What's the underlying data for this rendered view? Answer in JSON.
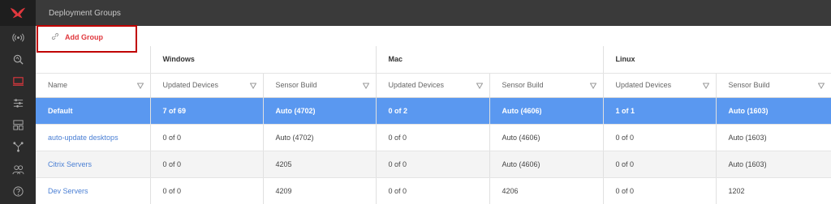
{
  "header": {
    "title": "Deployment Groups"
  },
  "toolbar": {
    "add_group_label": "Add Group"
  },
  "table": {
    "platform_groups": [
      "Windows",
      "Mac",
      "Linux"
    ],
    "columns": [
      "Name",
      "Updated Devices",
      "Sensor Build",
      "Updated Devices",
      "Sensor Build",
      "Updated Devices",
      "Sensor Build"
    ],
    "rows": [
      [
        "Default",
        "7 of 69",
        "Auto (4702)",
        "0 of 2",
        "Auto (4606)",
        "1 of 1",
        "Auto (1603)"
      ],
      [
        "auto-update desktops",
        "0 of 0",
        "Auto (4702)",
        "0 of 0",
        "Auto (4606)",
        "0 of 0",
        "Auto (1603)"
      ],
      [
        "Citrix Servers",
        "0 of 0",
        "4205",
        "0 of 0",
        "Auto (4606)",
        "0 of 0",
        "Auto (1603)"
      ],
      [
        "Dev Servers",
        "0 of 0",
        "4209",
        "0 of 0",
        "4206",
        "0 of 0",
        "1202"
      ]
    ]
  },
  "sidebar": {
    "items": [
      "logo-falcon-icon",
      "activity-icon",
      "investigate-icon",
      "hosts-icon",
      "configuration-icon",
      "dashboards-icon",
      "graph-icon",
      "users-icon",
      "support-icon"
    ]
  },
  "colors": {
    "accent": "#e0383e",
    "selected_row": "#5a98f0",
    "link": "#4a7fd4",
    "sidebar": "#2b2b2b"
  }
}
